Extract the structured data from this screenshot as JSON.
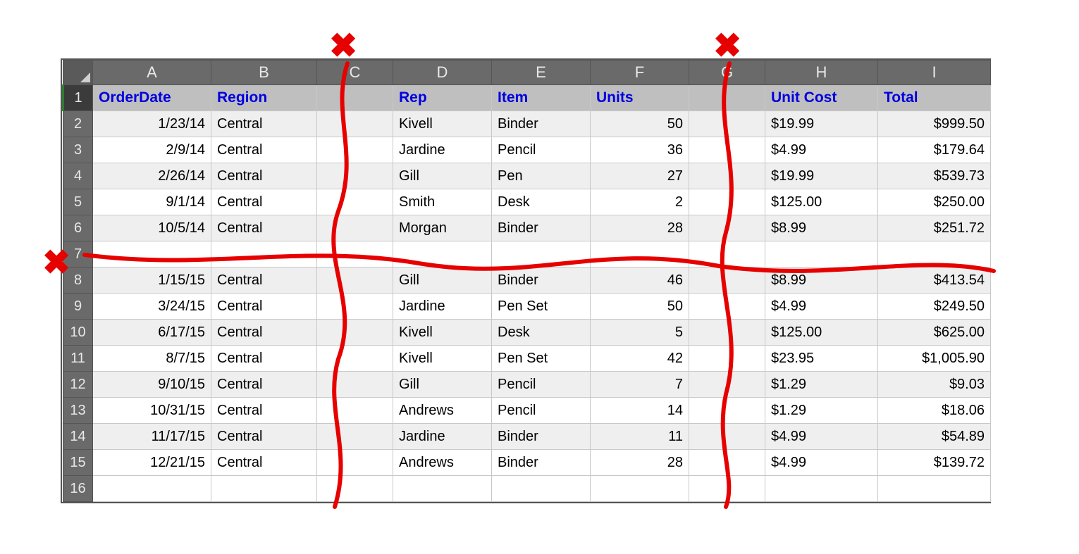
{
  "columns": [
    "A",
    "B",
    "C",
    "D",
    "E",
    "F",
    "G",
    "H",
    "I"
  ],
  "header": {
    "OrderDate": "OrderDate",
    "Region": "Region",
    "Rep": "Rep",
    "Item": "Item",
    "Units": "Units",
    "UnitCost": "Unit Cost",
    "Total": "Total"
  },
  "rows": [
    {
      "n": "1"
    },
    {
      "n": "2",
      "OrderDate": "1/23/14",
      "Region": "Central",
      "Rep": "Kivell",
      "Item": "Binder",
      "Units": "50",
      "UnitCost": "$19.99",
      "Total": "$999.50"
    },
    {
      "n": "3",
      "OrderDate": "2/9/14",
      "Region": "Central",
      "Rep": "Jardine",
      "Item": "Pencil",
      "Units": "36",
      "UnitCost": "$4.99",
      "Total": "$179.64"
    },
    {
      "n": "4",
      "OrderDate": "2/26/14",
      "Region": "Central",
      "Rep": "Gill",
      "Item": "Pen",
      "Units": "27",
      "UnitCost": "$19.99",
      "Total": "$539.73"
    },
    {
      "n": "5",
      "OrderDate": "9/1/14",
      "Region": "Central",
      "Rep": "Smith",
      "Item": "Desk",
      "Units": "2",
      "UnitCost": "$125.00",
      "Total": "$250.00"
    },
    {
      "n": "6",
      "OrderDate": "10/5/14",
      "Region": "Central",
      "Rep": "Morgan",
      "Item": "Binder",
      "Units": "28",
      "UnitCost": "$8.99",
      "Total": "$251.72"
    },
    {
      "n": "7"
    },
    {
      "n": "8",
      "OrderDate": "1/15/15",
      "Region": "Central",
      "Rep": "Gill",
      "Item": "Binder",
      "Units": "46",
      "UnitCost": "$8.99",
      "Total": "$413.54"
    },
    {
      "n": "9",
      "OrderDate": "3/24/15",
      "Region": "Central",
      "Rep": "Jardine",
      "Item": "Pen Set",
      "Units": "50",
      "UnitCost": "$4.99",
      "Total": "$249.50"
    },
    {
      "n": "10",
      "OrderDate": "6/17/15",
      "Region": "Central",
      "Rep": "Kivell",
      "Item": "Desk",
      "Units": "5",
      "UnitCost": "$125.00",
      "Total": "$625.00"
    },
    {
      "n": "11",
      "OrderDate": "8/7/15",
      "Region": "Central",
      "Rep": "Kivell",
      "Item": "Pen Set",
      "Units": "42",
      "UnitCost": "$23.95",
      "Total": "$1,005.90"
    },
    {
      "n": "12",
      "OrderDate": "9/10/15",
      "Region": "Central",
      "Rep": "Gill",
      "Item": "Pencil",
      "Units": "7",
      "UnitCost": "$1.29",
      "Total": "$9.03"
    },
    {
      "n": "13",
      "OrderDate": "10/31/15",
      "Region": "Central",
      "Rep": "Andrews",
      "Item": "Pencil",
      "Units": "14",
      "UnitCost": "$1.29",
      "Total": "$18.06"
    },
    {
      "n": "14",
      "OrderDate": "11/17/15",
      "Region": "Central",
      "Rep": "Jardine",
      "Item": "Binder",
      "Units": "11",
      "UnitCost": "$4.99",
      "Total": "$54.89"
    },
    {
      "n": "15",
      "OrderDate": "12/21/15",
      "Region": "Central",
      "Rep": "Andrews",
      "Item": "Binder",
      "Units": "28",
      "UnitCost": "$4.99",
      "Total": "$139.72"
    },
    {
      "n": "16"
    }
  ],
  "annotations": {
    "x_glyph": "✖",
    "blank_column_C": "C",
    "blank_column_G": "G",
    "blank_row": "7"
  },
  "chart_data": {
    "type": "table",
    "columns": [
      "OrderDate",
      "Region",
      "Rep",
      "Item",
      "Units",
      "Unit Cost",
      "Total"
    ],
    "blank_columns": [
      "C",
      "G"
    ],
    "blank_rows": [
      7
    ],
    "records": [
      {
        "OrderDate": "1/23/14",
        "Region": "Central",
        "Rep": "Kivell",
        "Item": "Binder",
        "Units": 50,
        "Unit Cost": 19.99,
        "Total": 999.5
      },
      {
        "OrderDate": "2/9/14",
        "Region": "Central",
        "Rep": "Jardine",
        "Item": "Pencil",
        "Units": 36,
        "Unit Cost": 4.99,
        "Total": 179.64
      },
      {
        "OrderDate": "2/26/14",
        "Region": "Central",
        "Rep": "Gill",
        "Item": "Pen",
        "Units": 27,
        "Unit Cost": 19.99,
        "Total": 539.73
      },
      {
        "OrderDate": "9/1/14",
        "Region": "Central",
        "Rep": "Smith",
        "Item": "Desk",
        "Units": 2,
        "Unit Cost": 125.0,
        "Total": 250.0
      },
      {
        "OrderDate": "10/5/14",
        "Region": "Central",
        "Rep": "Morgan",
        "Item": "Binder",
        "Units": 28,
        "Unit Cost": 8.99,
        "Total": 251.72
      },
      {
        "OrderDate": "1/15/15",
        "Region": "Central",
        "Rep": "Gill",
        "Item": "Binder",
        "Units": 46,
        "Unit Cost": 8.99,
        "Total": 413.54
      },
      {
        "OrderDate": "3/24/15",
        "Region": "Central",
        "Rep": "Jardine",
        "Item": "Pen Set",
        "Units": 50,
        "Unit Cost": 4.99,
        "Total": 249.5
      },
      {
        "OrderDate": "6/17/15",
        "Region": "Central",
        "Rep": "Kivell",
        "Item": "Desk",
        "Units": 5,
        "Unit Cost": 125.0,
        "Total": 625.0
      },
      {
        "OrderDate": "8/7/15",
        "Region": "Central",
        "Rep": "Kivell",
        "Item": "Pen Set",
        "Units": 42,
        "Unit Cost": 23.95,
        "Total": 1005.9
      },
      {
        "OrderDate": "9/10/15",
        "Region": "Central",
        "Rep": "Gill",
        "Item": "Pencil",
        "Units": 7,
        "Unit Cost": 1.29,
        "Total": 9.03
      },
      {
        "OrderDate": "10/31/15",
        "Region": "Central",
        "Rep": "Andrews",
        "Item": "Pencil",
        "Units": 14,
        "Unit Cost": 1.29,
        "Total": 18.06
      },
      {
        "OrderDate": "11/17/15",
        "Region": "Central",
        "Rep": "Jardine",
        "Item": "Binder",
        "Units": 11,
        "Unit Cost": 4.99,
        "Total": 54.89
      },
      {
        "OrderDate": "12/21/15",
        "Region": "Central",
        "Rep": "Andrews",
        "Item": "Binder",
        "Units": 28,
        "Unit Cost": 4.99,
        "Total": 139.72
      }
    ]
  }
}
